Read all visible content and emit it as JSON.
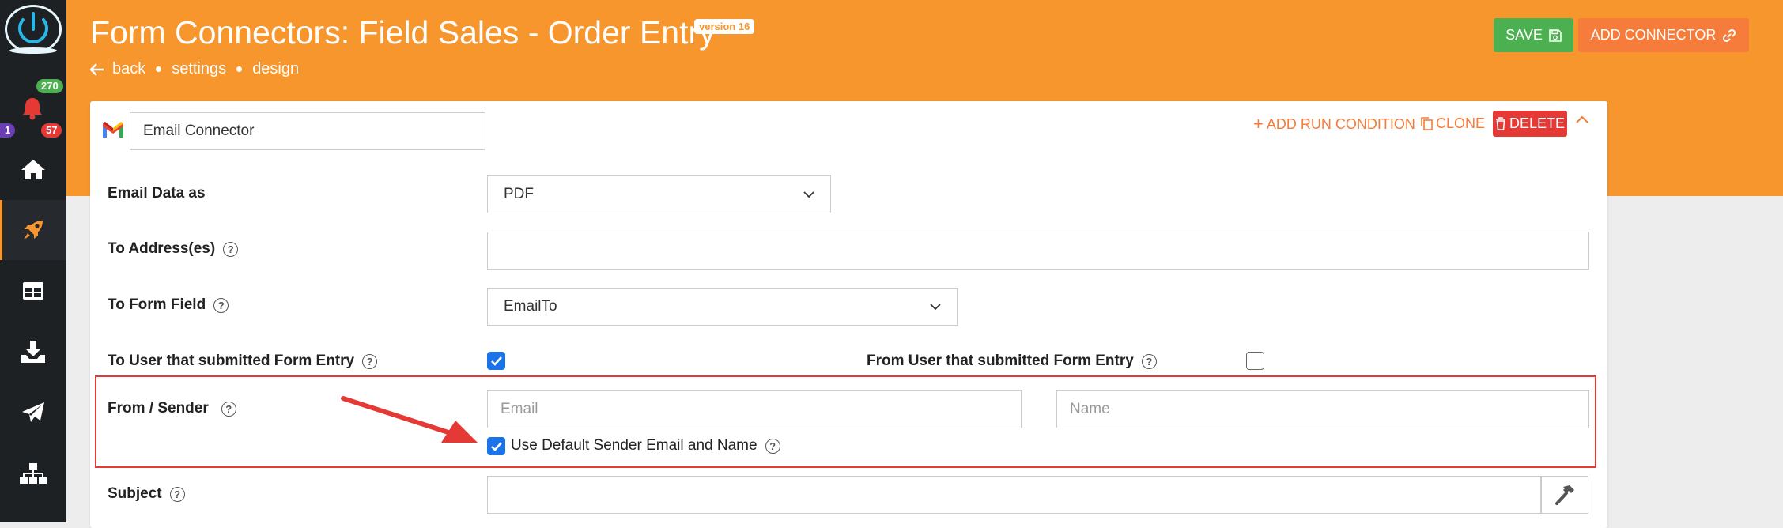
{
  "header": {
    "title": "Form Connectors: Field Sales - Order Entry",
    "version": "version 16",
    "breadcrumb": [
      "back",
      "settings",
      "design"
    ],
    "save_label": "SAVE",
    "add_connector_label": "ADD CONNECTOR"
  },
  "sidebar": {
    "badges": {
      "green": "270",
      "purple": "1",
      "red": "57"
    }
  },
  "connector": {
    "name": "Email Connector",
    "actions": {
      "add_run_condition": "ADD RUN CONDITION",
      "clone": "CLONE",
      "delete": "DELETE"
    }
  },
  "form": {
    "email_data_as": {
      "label": "Email Data as",
      "value": "PDF"
    },
    "to_addresses": {
      "label": "To Address(es)",
      "value": ""
    },
    "to_form_field": {
      "label": "To Form Field",
      "value": "EmailTo"
    },
    "to_user": {
      "label": "To User that submitted Form Entry",
      "checked": true
    },
    "from_user": {
      "label": "From User that submitted Form Entry",
      "checked": false
    },
    "from_sender": {
      "label": "From / Sender",
      "email_placeholder": "Email",
      "name_placeholder": "Name",
      "use_default_label": "Use Default Sender Email and Name",
      "use_default_checked": true
    },
    "subject": {
      "label": "Subject",
      "value": ""
    }
  },
  "colors": {
    "header_orange": "#f7962d",
    "save_green": "#4caf50",
    "add_orange": "#f57c3a",
    "delete_red": "#e53935",
    "checkbox_blue": "#1a73e8",
    "sidebar_dark": "#1d2124"
  }
}
